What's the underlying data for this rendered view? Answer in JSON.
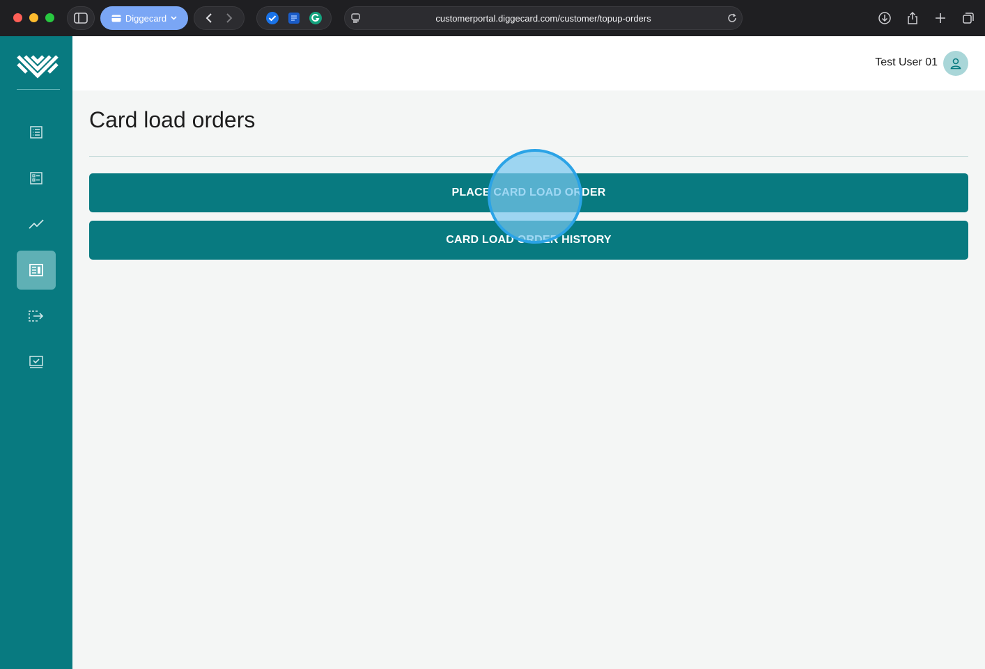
{
  "browser": {
    "tab_group_label": "Diggecard",
    "url": "customerportal.diggecard.com/customer/topup-orders"
  },
  "colors": {
    "brand": "#087a80",
    "sidebar_active": "#5fb0b5",
    "click_highlight": "#2ba3e6"
  },
  "sidebar": {
    "items": [
      {
        "icon": "list-icon",
        "active": false
      },
      {
        "icon": "checklist-icon",
        "active": false
      },
      {
        "icon": "trend-chart-icon",
        "active": false
      },
      {
        "icon": "orders-icon",
        "active": true
      },
      {
        "icon": "transfer-icon",
        "active": false
      },
      {
        "icon": "monitor-check-icon",
        "active": false
      }
    ]
  },
  "header": {
    "user_name": "Test User 01"
  },
  "main": {
    "title": "Card load orders",
    "buttons": {
      "place_order": "PLACE CARD LOAD ORDER",
      "history": "CARD LOAD ORDER HISTORY"
    }
  }
}
